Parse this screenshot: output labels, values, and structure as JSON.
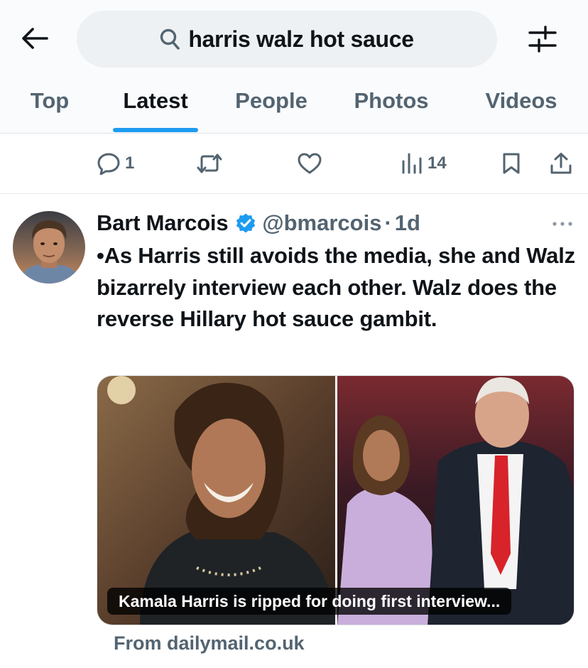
{
  "header": {
    "back_icon": "arrow-left-icon",
    "search": {
      "icon": "search-icon",
      "query": "harris walz hot sauce"
    },
    "filter_icon": "sliders-icon"
  },
  "tabs": [
    {
      "label": "Top",
      "active": false
    },
    {
      "label": "Latest",
      "active": true
    },
    {
      "label": "People",
      "active": false
    },
    {
      "label": "Photos",
      "active": false
    },
    {
      "label": "Videos",
      "active": false
    }
  ],
  "previous_tweet_actions": {
    "reply_count": "1",
    "retweet_count": "",
    "like_count": "",
    "views_count": "14",
    "icons": [
      "reply-icon",
      "retweet-icon",
      "heart-icon",
      "views-icon",
      "bookmark-icon",
      "share-icon"
    ]
  },
  "tweet": {
    "author_name": "Bart Marcois",
    "verified": true,
    "handle": "@bmarcois",
    "separator": "·",
    "time": "1d",
    "text": "•As Harris still avoids the media, she and Walz bizarrely interview each other. Walz does the reverse Hillary hot sauce gambit.",
    "card": {
      "caption": "Kamala Harris is ripped for doing first interview...",
      "source": "From dailymail.co.uk"
    }
  },
  "colors": {
    "accent": "#1d9bf0",
    "text_primary": "#0f1419",
    "text_secondary": "#536471",
    "search_bg": "#eef1f3"
  }
}
